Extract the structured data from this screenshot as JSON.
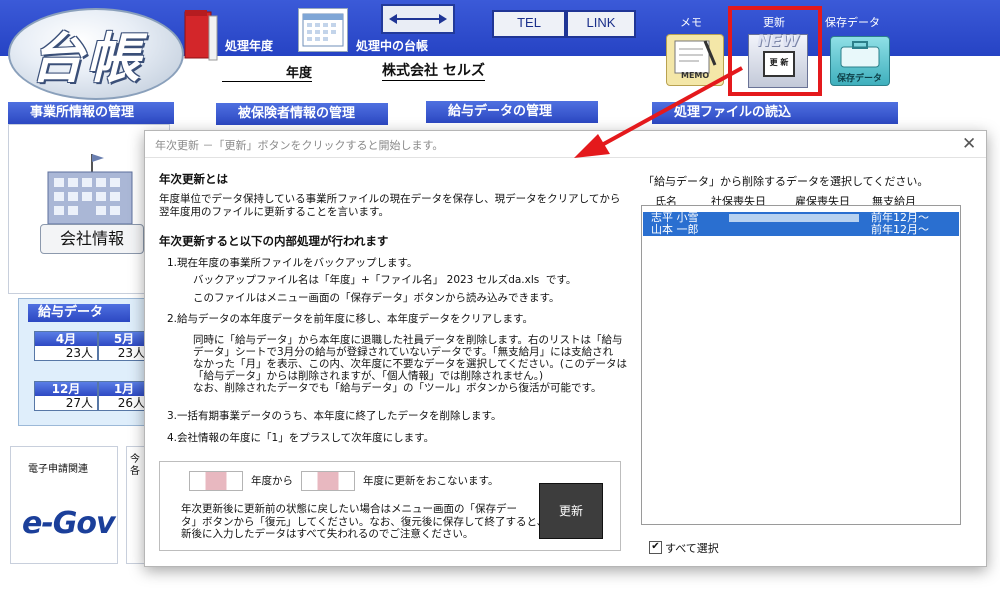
{
  "header": {
    "logo": "台帳",
    "processing_year_label": "処理年度",
    "current_ledger_label": "処理中の台帳",
    "tel_label": "TEL",
    "link_label": "LINK",
    "memo_label": "メモ",
    "update_label": "更新",
    "save_data_label": "保存データ",
    "memo_icon_text": "MEMO",
    "new_icon_text": "NEW",
    "new_icon_sub": "更 新",
    "save_icon_text": "保存データ",
    "year_value": "年度",
    "company_name": "株式会社 セルズ"
  },
  "sections": {
    "office": "事業所情報の管理",
    "insured": "被保険者情報の管理",
    "salary": "給与データの管理",
    "file_load": "処理ファイルの読込"
  },
  "company_button": "会社情報",
  "salary_panel": {
    "title": "給与データ",
    "row1": [
      {
        "month": "4月",
        "count": "23人"
      },
      {
        "month": "5月",
        "count": "23人"
      }
    ],
    "row2": [
      {
        "month": "12月",
        "count": "27人"
      },
      {
        "month": "1月",
        "count": "26人"
      }
    ]
  },
  "egov": {
    "label": "電子申請関連",
    "logo": "e-Gov",
    "partial_text": "今\n各"
  },
  "dialog": {
    "title": "年次更新 －「更新」ボタンをクリックすると開始します。",
    "close": "✕",
    "heading1": "年次更新とは",
    "para1": "年度単位でデータ保持している事業所ファイルの現在データを保存し、現データをクリアしてから\n翌年度用のファイルに更新することを言います。",
    "heading2": "年次更新すると以下の内部処理が行われます",
    "step1": "1.現在年度の事業所ファイルをバックアップします。",
    "step1a": "バックアップファイル名は「年度」+「ファイル名」 2023 セルズda.xls  です。",
    "step1b": "このファイルはメニュー画面の「保存データ」ボタンから読み込みできます。",
    "step2": "2.給与データの本年度データを前年度に移し、本年度データをクリアします。",
    "step2a": "同時に「給与データ」から本年度に退職した社員データを削除します。右のリストは「給与\nデータ」シートで3月分の給与が登録されていないデータです。「無支給月」には支給され\nなかった「月」を表示、この内、次年度に不要なデータを選択してください。(このデータは\n「給与データ」からは削除されますが、「個人情報」では削除されません。)\nなお、削除されたデータでも「給与データ」の「ツール」ボタンから復活が可能です。",
    "step3": "3.一括有期事業データのうち、本年度に終了したデータを削除します。",
    "step4": "4.会社情報の年度に「1」をプラスして次年度にします。",
    "from_label": "年度から",
    "to_label": "年度に更新をおこないます。",
    "note": "年次更新後に更新前の状態に戻したい場合はメニュー画面の「保存デー\nタ」ボタンから「復元」してください。なお、復元後に保存して終了すると、更\n新後に入力したデータはすべて失われるのでご注意ください。",
    "update_button": "更新",
    "list_label": "「給与データ」から削除するデータを選択してください。",
    "columns": [
      "氏名",
      "社保喪失日",
      "雇保喪失日",
      "無支給月"
    ],
    "rows": [
      {
        "name": "志平 小雪",
        "unpaid": "前年12月～"
      },
      {
        "name": "山本 一郎",
        "unpaid": "前年12月～"
      }
    ],
    "select_all_label": "すべて選択",
    "select_all_checked": "✔"
  }
}
